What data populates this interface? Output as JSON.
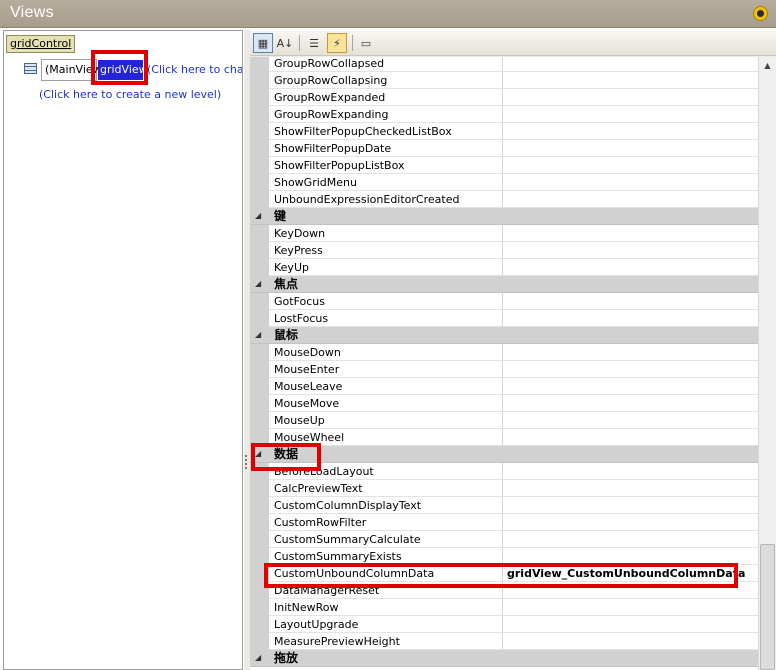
{
  "window": {
    "title": "Views"
  },
  "left_panel": {
    "grid_control_label": "gridControl",
    "level_label": "(MainView)",
    "selected_view": "gridView",
    "click_to_change": "(Click here to change",
    "click_to_create": "(Click here to create a new level)"
  },
  "toolbar": {
    "buttons": [
      {
        "icon": "categorized-icon",
        "glyph": "▦"
      },
      {
        "icon": "alphabetical-sort-icon",
        "glyph": "A↓"
      },
      {
        "icon": "properties-icon",
        "glyph": "☰"
      },
      {
        "icon": "events-icon",
        "glyph": "⚡"
      },
      {
        "icon": "property-pages-icon",
        "glyph": "▭"
      }
    ]
  },
  "property_grid": {
    "rows": [
      {
        "type": "item",
        "name": "GroupRowCollapsed",
        "value": ""
      },
      {
        "type": "item",
        "name": "GroupRowCollapsing",
        "value": ""
      },
      {
        "type": "item",
        "name": "GroupRowExpanded",
        "value": ""
      },
      {
        "type": "item",
        "name": "GroupRowExpanding",
        "value": ""
      },
      {
        "type": "item",
        "name": "ShowFilterPopupCheckedListBox",
        "value": ""
      },
      {
        "type": "item",
        "name": "ShowFilterPopupDate",
        "value": ""
      },
      {
        "type": "item",
        "name": "ShowFilterPopupListBox",
        "value": ""
      },
      {
        "type": "item",
        "name": "ShowGridMenu",
        "value": ""
      },
      {
        "type": "item",
        "name": "UnboundExpressionEditorCreated",
        "value": ""
      },
      {
        "type": "category",
        "name": "键"
      },
      {
        "type": "item",
        "name": "KeyDown",
        "value": ""
      },
      {
        "type": "item",
        "name": "KeyPress",
        "value": ""
      },
      {
        "type": "item",
        "name": "KeyUp",
        "value": ""
      },
      {
        "type": "category",
        "name": "焦点"
      },
      {
        "type": "item",
        "name": "GotFocus",
        "value": ""
      },
      {
        "type": "item",
        "name": "LostFocus",
        "value": ""
      },
      {
        "type": "category",
        "name": "鼠标"
      },
      {
        "type": "item",
        "name": "MouseDown",
        "value": ""
      },
      {
        "type": "item",
        "name": "MouseEnter",
        "value": ""
      },
      {
        "type": "item",
        "name": "MouseLeave",
        "value": ""
      },
      {
        "type": "item",
        "name": "MouseMove",
        "value": ""
      },
      {
        "type": "item",
        "name": "MouseUp",
        "value": ""
      },
      {
        "type": "item",
        "name": "MouseWheel",
        "value": ""
      },
      {
        "type": "category",
        "name": "数据"
      },
      {
        "type": "item",
        "name": "BeforeLoadLayout",
        "value": ""
      },
      {
        "type": "item",
        "name": "CalcPreviewText",
        "value": ""
      },
      {
        "type": "item",
        "name": "CustomColumnDisplayText",
        "value": ""
      },
      {
        "type": "item",
        "name": "CustomRowFilter",
        "value": ""
      },
      {
        "type": "item",
        "name": "CustomSummaryCalculate",
        "value": ""
      },
      {
        "type": "item",
        "name": "CustomSummaryExists",
        "value": ""
      },
      {
        "type": "item",
        "name": "CustomUnboundColumnData",
        "value": "gridView_CustomUnboundColumnData"
      },
      {
        "type": "item",
        "name": "DataManagerReset",
        "value": ""
      },
      {
        "type": "item",
        "name": "InitNewRow",
        "value": ""
      },
      {
        "type": "item",
        "name": "LayoutUpgrade",
        "value": ""
      },
      {
        "type": "item",
        "name": "MeasurePreviewHeight",
        "value": ""
      },
      {
        "type": "category",
        "name": "拖放"
      }
    ]
  },
  "colors": {
    "highlight": "#e00000",
    "selected_view_bg": "#2323d8",
    "link": "#2131c9",
    "category_bg": "#d1d1d1"
  }
}
